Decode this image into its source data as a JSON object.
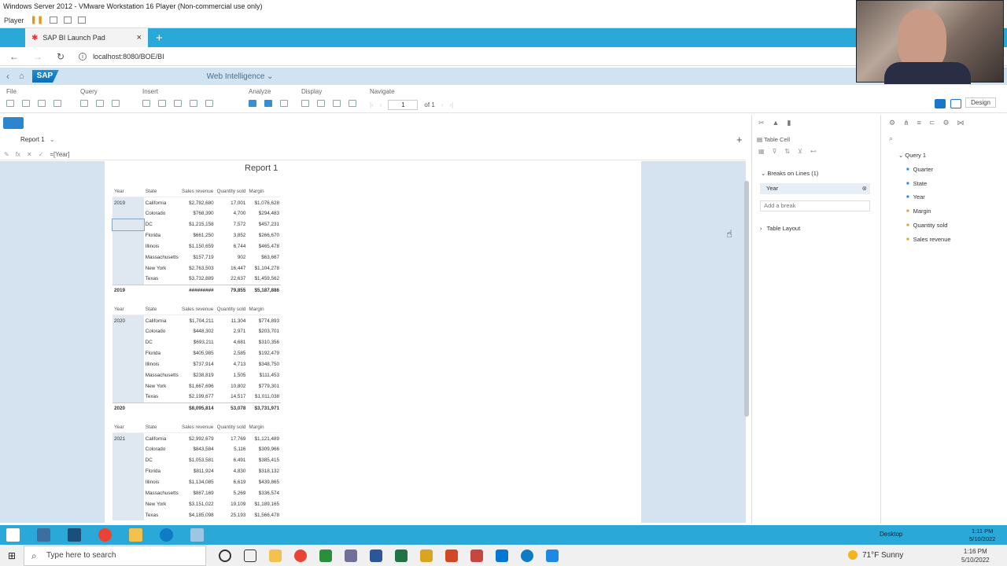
{
  "vm": {
    "title": "Windows Server 2012 - VMware Workstation 16 Player (Non-commercial use only)",
    "player_label": "Player"
  },
  "browser": {
    "tab_title": "SAP BI Launch Pad",
    "url": "localhost:8080/BOE/BI"
  },
  "sap": {
    "logo": "SAP",
    "app_name": "Web Intelligence"
  },
  "ribbon": {
    "groups": [
      "File",
      "Query",
      "Insert",
      "Analyze",
      "Display",
      "Navigate"
    ],
    "page_value": "1",
    "page_of": "of 1",
    "design_label": "Design"
  },
  "report": {
    "tab_label": "Report 1",
    "formula": "=[Year]",
    "title": "Report 1"
  },
  "table_headers": [
    "Year",
    "State",
    "Sales revenue",
    "Quantity sold",
    "Margin"
  ],
  "blocks": [
    {
      "year": "2019",
      "rows": [
        [
          "California",
          "$2,782,680",
          "17,001",
          "$1,076,628"
        ],
        [
          "Colorado",
          "$768,390",
          "4,700",
          "$294,483"
        ],
        [
          "DC",
          "$1,215,158",
          "7,572",
          "$457,231"
        ],
        [
          "Florida",
          "$661,250",
          "3,852",
          "$266,670"
        ],
        [
          "Illinois",
          "$1,150,659",
          "6,744",
          "$465,478"
        ],
        [
          "Massachusetts",
          "$157,719",
          "902",
          "$63,667"
        ],
        [
          "New York",
          "$2,763,503",
          "16,447",
          "$1,104,278"
        ],
        [
          "Texas",
          "$3,732,889",
          "22,637",
          "$1,459,562"
        ]
      ],
      "total": [
        "2019",
        "",
        "#########",
        "79,855",
        "$5,187,886"
      ]
    },
    {
      "year": "2020",
      "rows": [
        [
          "California",
          "$1,704,211",
          "11,304",
          "$774,893"
        ],
        [
          "Colorado",
          "$448,302",
          "2,971",
          "$203,701"
        ],
        [
          "DC",
          "$693,211",
          "4,681",
          "$310,356"
        ],
        [
          "Florida",
          "$405,985",
          "2,585",
          "$192,479"
        ],
        [
          "Illinois",
          "$737,914",
          "4,713",
          "$348,750"
        ],
        [
          "Massachusetts",
          "$238,819",
          "1,505",
          "$111,453"
        ],
        [
          "New York",
          "$1,667,696",
          "10,802",
          "$779,301"
        ],
        [
          "Texas",
          "$2,199,677",
          "14,517",
          "$1,011,038"
        ]
      ],
      "total": [
        "2020",
        "",
        "$8,095,814",
        "53,078",
        "$3,731,971"
      ]
    },
    {
      "year": "2021",
      "rows": [
        [
          "California",
          "$2,992,679",
          "17,769",
          "$1,121,489"
        ],
        [
          "Colorado",
          "$843,584",
          "5,116",
          "$309,966"
        ],
        [
          "DC",
          "$1,053,581",
          "6,491",
          "$385,415"
        ],
        [
          "Florida",
          "$811,924",
          "4,830",
          "$318,132"
        ],
        [
          "Illinois",
          "$1,134,085",
          "6,619",
          "$439,865"
        ],
        [
          "Massachusetts",
          "$887,169",
          "5,269",
          "$336,574"
        ],
        [
          "New York",
          "$3,151,022",
          "19,109",
          "$1,189,165"
        ],
        [
          "Texas",
          "$4,185,098",
          "25,193",
          "$1,566,478"
        ]
      ]
    }
  ],
  "props": {
    "section": "Table Cell",
    "breaks_header": "Breaks on Lines",
    "breaks_count": "(1)",
    "break_item": "Year",
    "add_break": "Add a break",
    "table_layout": "Table Layout"
  },
  "data_panel": {
    "query": "Query 1",
    "objects": [
      {
        "name": "Quarter",
        "kind": "dimension"
      },
      {
        "name": "State",
        "kind": "dimension"
      },
      {
        "name": "Year",
        "kind": "dimension"
      },
      {
        "name": "Margin",
        "kind": "measure"
      },
      {
        "name": "Quantity sold",
        "kind": "measure"
      },
      {
        "name": "Sales revenue",
        "kind": "measure"
      }
    ]
  },
  "remote_taskbar": {
    "desktop_label": "Desktop",
    "time": "1:11 PM",
    "date": "5/10/2022"
  },
  "host_taskbar": {
    "search_placeholder": "Type here to search",
    "weather": "71°F  Sunny",
    "time": "1:16 PM",
    "date": "5/10/2022"
  },
  "colors": {
    "accent": "#2aa8d8",
    "sap_blue": "#0a6fb8",
    "canvas": "#d4e3ef"
  }
}
